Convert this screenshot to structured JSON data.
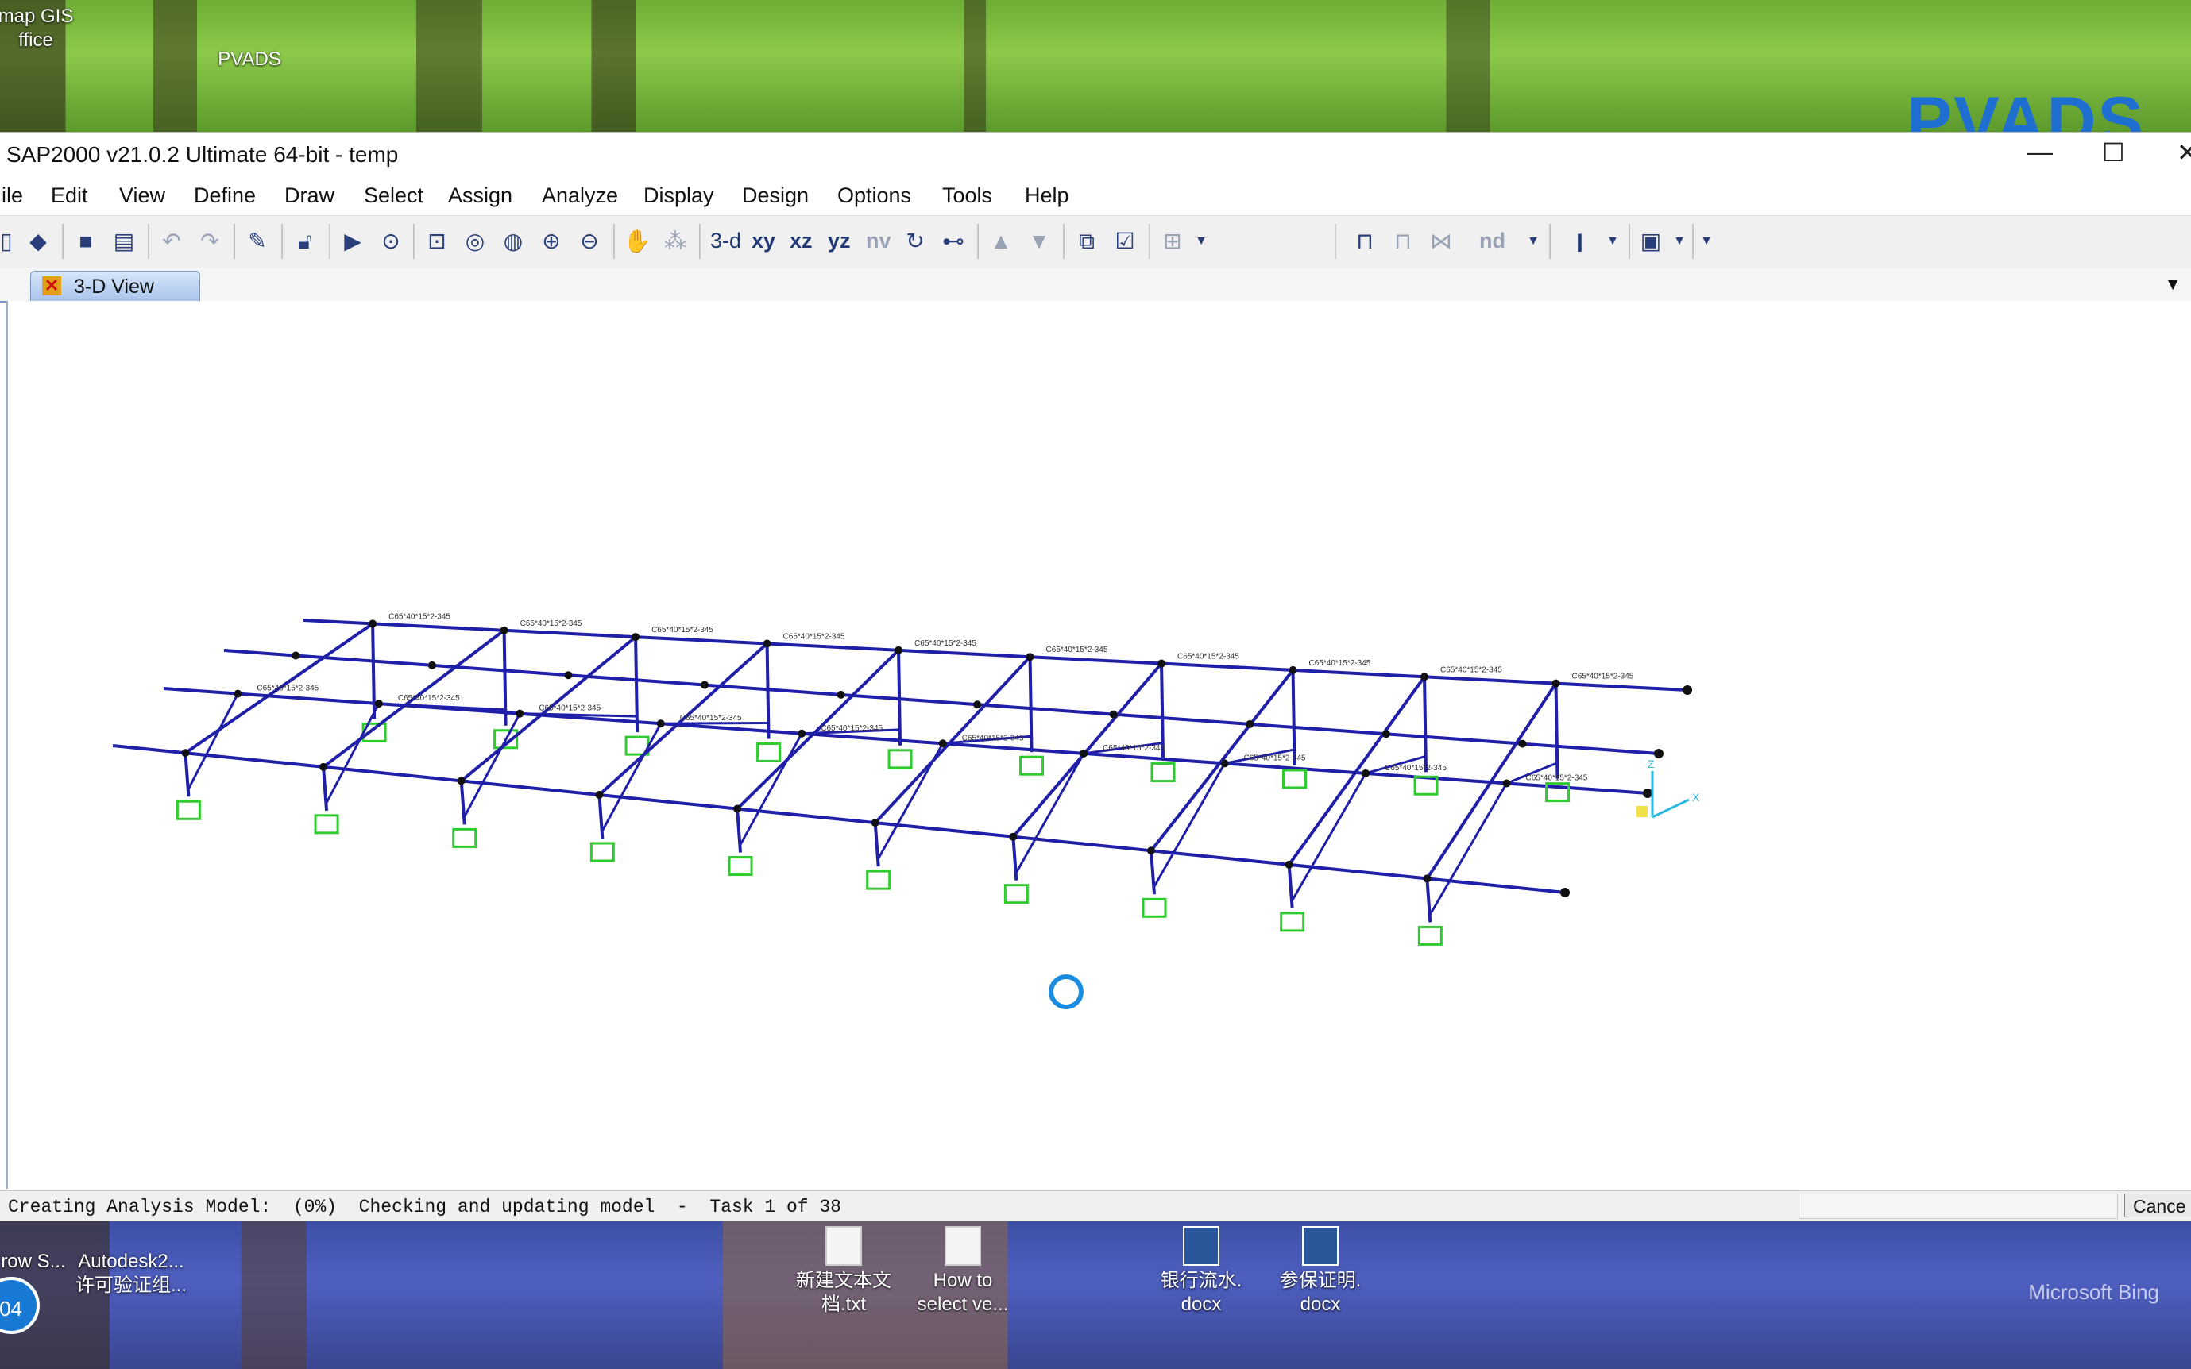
{
  "desktop": {
    "brand_text": "PVADS",
    "bing_text": "Microsoft Bing",
    "badge_text": "04",
    "top_icons": [
      {
        "label": "map GIS\nffice"
      },
      {
        "label": "PVADS"
      }
    ],
    "bottom_icons": [
      {
        "label": "row S..."
      },
      {
        "label": "Autodesk2...\n许可验证组..."
      },
      {
        "label": "新建文本文\n档.txt"
      },
      {
        "label": "How to\nselect ve..."
      },
      {
        "label": "银行流水.\ndocx"
      },
      {
        "label": "参保证明.\ndocx"
      }
    ]
  },
  "window": {
    "title": "SAP2000 v21.0.2 Ultimate 64-bit - temp",
    "controls": {
      "minimize": "—",
      "maximize": "☐",
      "close": "✕"
    }
  },
  "menu": [
    "ile",
    "Edit",
    "View",
    "Define",
    "Draw",
    "Select",
    "Assign",
    "Analyze",
    "Display",
    "Design",
    "Options",
    "Tools",
    "Help"
  ],
  "toolbar": {
    "view_3d": "3-d",
    "view_xy": "xy",
    "view_xz": "xz",
    "view_yz": "yz",
    "view_nv": "nv",
    "view_nd": "nd",
    "text_tool": "I"
  },
  "tabs": [
    {
      "label": "3-D View"
    }
  ],
  "model": {
    "frame_color": "#1f1fa8",
    "support_color": "#2fcc2f",
    "axis_color": "#2ab8e0",
    "section_label": "C65*40*15*2-345",
    "axis_labels": {
      "x": "X",
      "z": "Z"
    }
  },
  "status": {
    "text": "Creating Analysis Model:  (0%)  Checking and updating model  -  Task 1 of 38",
    "cancel": "Cance"
  }
}
